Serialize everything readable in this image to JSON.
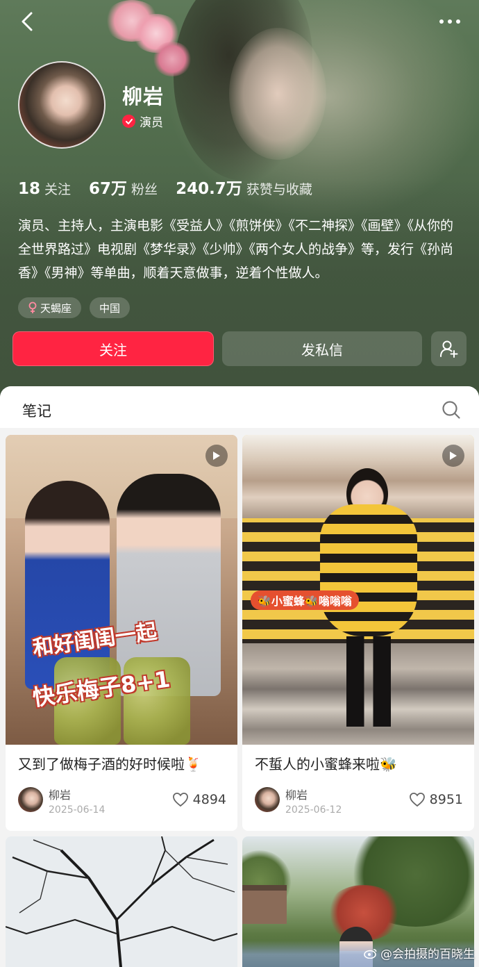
{
  "profile": {
    "name": "柳岩",
    "verified_label": "演员",
    "stats": [
      {
        "num": "18",
        "label": "关注"
      },
      {
        "num": "67万",
        "label": "粉丝"
      },
      {
        "num": "240.7万",
        "label": "获赞与收藏"
      }
    ],
    "bio": "演员、主持人，主演电影《受益人》《煎饼侠》《不二神探》《画壁》《从你的全世界路过》电视剧《梦华录》《少帅》《两个女人的战争》等，发行《孙尚香》《男神》等单曲，顺着天意做事，逆着个性做人。",
    "tags": [
      {
        "icon": "female-icon",
        "label": "天蝎座"
      },
      {
        "label": "中国"
      }
    ]
  },
  "actions": {
    "follow": "关注",
    "message": "发私信"
  },
  "tabs": {
    "notes": "笔记"
  },
  "posts": [
    {
      "title": "又到了做梅子酒的好时候啦🍹",
      "author": "柳岩",
      "date": "2025-06-14",
      "likes": "4894",
      "cover_text": [
        "和好闺闺一起",
        "快乐梅子8+1"
      ]
    },
    {
      "title": "不蜇人的小蜜蜂来啦🐝",
      "author": "柳岩",
      "date": "2025-06-12",
      "likes": "8951",
      "cover_text": [
        "🐝小蜜蜂🐝嗡嗡嗡"
      ]
    }
  ],
  "watermark": "@会拍摄的百晓生",
  "colors": {
    "accent": "#ff2442",
    "header_bg": "#4d6549"
  }
}
